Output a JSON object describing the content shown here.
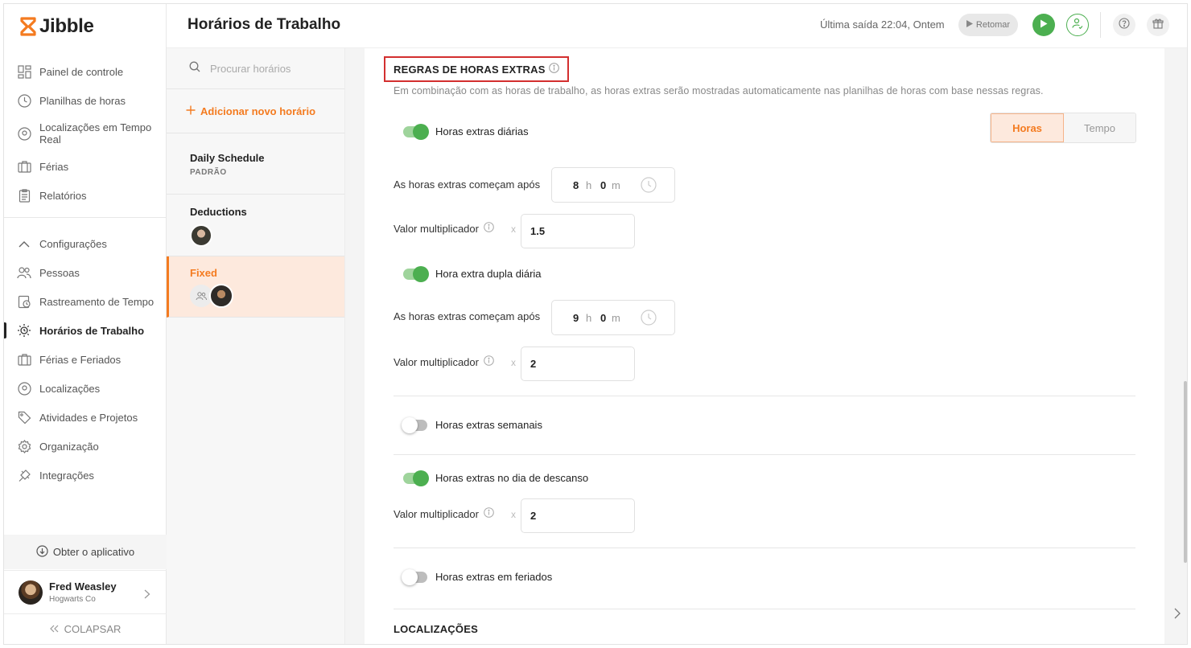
{
  "app": {
    "name": "Jibble"
  },
  "sidebar": {
    "items": [
      {
        "label": "Painel de controle",
        "icon": "dashboard-icon"
      },
      {
        "label": "Planilhas de horas",
        "icon": "clock-icon"
      },
      {
        "label": "Localizações em Tempo Real",
        "icon": "location-pin-icon"
      },
      {
        "label": "Férias",
        "icon": "suitcase-icon"
      },
      {
        "label": "Relatórios",
        "icon": "clipboard-icon"
      }
    ],
    "settings": {
      "label": "Configurações",
      "items": [
        {
          "label": "Pessoas",
          "icon": "people-icon"
        },
        {
          "label": "Rastreamento de Tempo",
          "icon": "time-tracking-icon"
        },
        {
          "label": "Horários de Trabalho",
          "icon": "work-schedule-icon",
          "active": true
        },
        {
          "label": "Férias e Feriados",
          "icon": "suitcase-icon"
        },
        {
          "label": "Localizações",
          "icon": "location-pin-icon"
        },
        {
          "label": "Atividades e Projetos",
          "icon": "tag-icon"
        },
        {
          "label": "Organização",
          "icon": "gear-icon"
        },
        {
          "label": "Integrações",
          "icon": "plug-icon"
        }
      ]
    },
    "get_app": "Obter o aplicativo",
    "user": {
      "name": "Fred Weasley",
      "org": "Hogwarts Co"
    },
    "collapse": "COLAPSAR"
  },
  "header": {
    "title": "Horários de Trabalho",
    "last_out": "Última saída 22:04, Ontem",
    "resume": "Retomar"
  },
  "schedules": {
    "search_placeholder": "Procurar horários",
    "add_new": "Adicionar novo horário",
    "items": [
      {
        "title": "Daily Schedule",
        "sub": "PADRÃO"
      },
      {
        "title": "Deductions"
      },
      {
        "title": "Fixed",
        "active": true
      }
    ]
  },
  "overtime": {
    "heading": "REGRAS DE HORAS EXTRAS",
    "description": "Em combinação com as horas de trabalho, as horas extras serão mostradas automaticamente nas planilhas de horas com base nessas regras.",
    "units": {
      "hours": "Horas",
      "time": "Tempo",
      "selected": "hours"
    },
    "daily": {
      "label": "Horas extras diárias",
      "enabled": true,
      "starts_after_label": "As horas extras começam após",
      "hours": "8",
      "minutes": "0",
      "multiplier_label": "Valor multiplicador",
      "multiplier": "1.5"
    },
    "daily_double": {
      "label": "Hora extra dupla diária",
      "enabled": true,
      "starts_after_label": "As horas extras começam após",
      "hours": "9",
      "minutes": "0",
      "multiplier_label": "Valor multiplicador",
      "multiplier": "2"
    },
    "weekly": {
      "label": "Horas extras semanais",
      "enabled": false
    },
    "rest_day": {
      "label": "Horas extras no dia de descanso",
      "enabled": true,
      "multiplier_label": "Valor multiplicador",
      "multiplier": "2"
    },
    "holidays": {
      "label": "Horas extras em feriados",
      "enabled": false
    },
    "unit_h": "h",
    "unit_m": "m",
    "times": "x"
  },
  "locations": {
    "heading": "LOCALIZAÇÕES"
  },
  "colors": {
    "accent": "#f47b20",
    "green": "#4caf50",
    "red_outline": "#d32f2f"
  }
}
